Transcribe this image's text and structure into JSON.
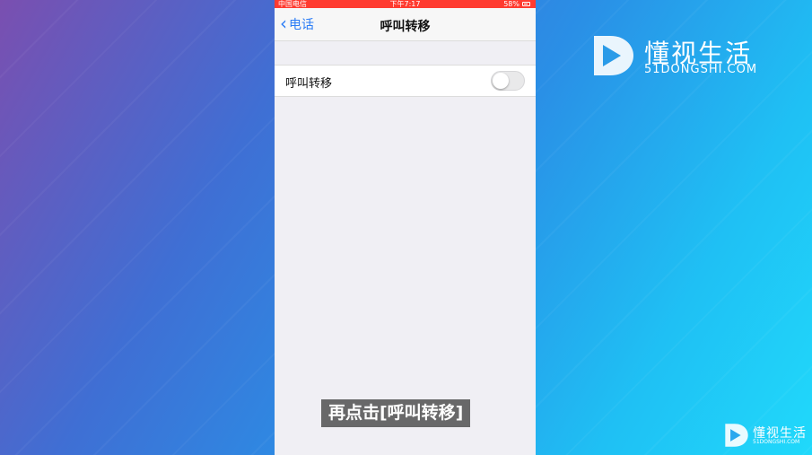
{
  "status_bar": {
    "carrier": "中国电信",
    "time": "下午7:17",
    "battery": "58%"
  },
  "nav": {
    "back_label": "电话",
    "title": "呼叫转移"
  },
  "settings": {
    "call_forwarding_label": "呼叫转移",
    "call_forwarding_on": false
  },
  "overlay": {
    "subtitle": "再点击[呼叫转移]"
  },
  "watermark": {
    "name": "懂视生活",
    "domain": "51DONGSHI.COM"
  },
  "colors": {
    "status_bar": "#ff3b30",
    "ios_blue": "#2b7cf6"
  }
}
